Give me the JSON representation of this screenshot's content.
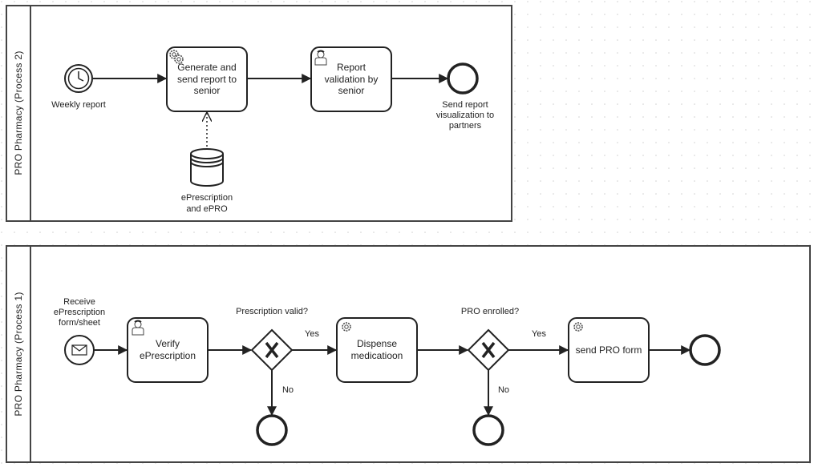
{
  "colors": {
    "stroke": "#222222",
    "background": "#ffffff",
    "grid_dot": "#d0d0d0",
    "pool_border": "#444444"
  },
  "pools": [
    {
      "title": "PRO Pharmacy  (Process 2)",
      "start_event": {
        "type": "timer",
        "icon": "clock-icon",
        "label": "Weekly report"
      },
      "tasks": [
        {
          "type": "service",
          "icon": "gear-icon",
          "lines": [
            "Generate and",
            "send report to",
            "senior"
          ]
        },
        {
          "type": "user",
          "icon": "user-icon",
          "lines": [
            "Report",
            "validation by",
            "senior"
          ]
        }
      ],
      "data_store": {
        "icon": "database-icon",
        "lines": [
          "ePrescription",
          "and ePRO"
        ]
      },
      "end_event": {
        "lines": [
          "Send report",
          "visualization to",
          "partners"
        ]
      }
    },
    {
      "title": "PRO Pharmacy  (Process 1)",
      "start_event": {
        "type": "message",
        "icon": "envelope-icon",
        "lines": [
          "Receive",
          "ePrescription",
          "form/sheet"
        ]
      },
      "tasks": [
        {
          "type": "user",
          "icon": "user-icon",
          "lines": [
            "Verify",
            "ePrescription"
          ]
        },
        {
          "type": "service",
          "icon": "gear-icon",
          "lines": [
            "Dispense",
            "medicatioon"
          ]
        },
        {
          "type": "service",
          "icon": "gear-icon",
          "lines": [
            "send PRO form"
          ]
        }
      ],
      "gateways": [
        {
          "type": "exclusive",
          "label": "Prescription valid?",
          "yes": "Yes",
          "no": "No"
        },
        {
          "type": "exclusive",
          "label": "PRO enrolled?",
          "yes": "Yes",
          "no": "No"
        }
      ]
    }
  ]
}
